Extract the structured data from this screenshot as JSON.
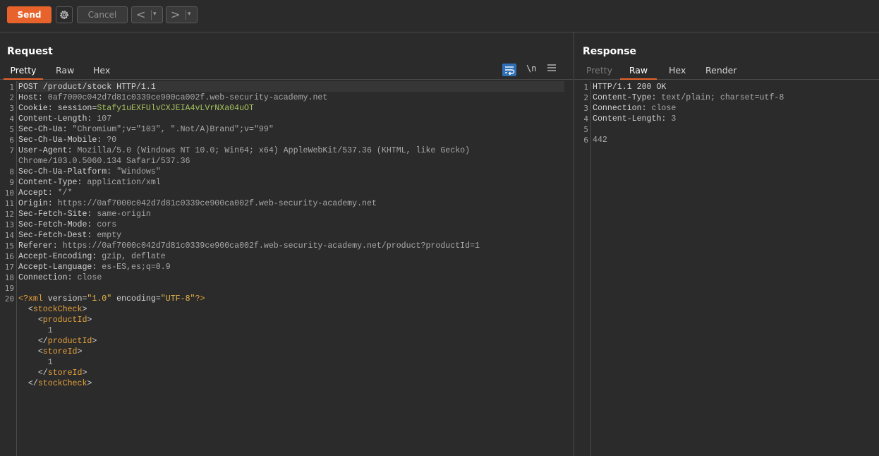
{
  "toolbar": {
    "send_label": "Send",
    "cancel_label": "Cancel",
    "back_arrow": "<",
    "forward_arrow": ">",
    "dropdown_glyph": "▾"
  },
  "request": {
    "title": "Request",
    "tabs": [
      "Pretty",
      "Raw",
      "Hex"
    ],
    "active_tab": "Pretty",
    "tool_newline_label": "\\n",
    "lines": [
      {
        "n": "1",
        "parts": [
          {
            "c": "k",
            "t": "POST /product/stock HTTP/1.1"
          }
        ]
      },
      {
        "n": "2",
        "parts": [
          {
            "c": "k",
            "t": "Host: "
          },
          {
            "c": "v",
            "t": "0af7000c042d7d81c0339ce900ca002f.web-security-academy.net"
          }
        ]
      },
      {
        "n": "3",
        "parts": [
          {
            "c": "k",
            "t": "Cookie: session="
          },
          {
            "c": "g",
            "t": "Stafy1uEXFUlvCXJEIA4vLVrNXa04uOT"
          }
        ]
      },
      {
        "n": "4",
        "parts": [
          {
            "c": "k",
            "t": "Content-Length: "
          },
          {
            "c": "v",
            "t": "107"
          }
        ]
      },
      {
        "n": "5",
        "parts": [
          {
            "c": "k",
            "t": "Sec-Ch-Ua: "
          },
          {
            "c": "v",
            "t": "\"Chromium\";v=\"103\", \".Not/A)Brand\";v=\"99\""
          }
        ]
      },
      {
        "n": "6",
        "parts": [
          {
            "c": "k",
            "t": "Sec-Ch-Ua-Mobile: "
          },
          {
            "c": "v",
            "t": "?0"
          }
        ]
      },
      {
        "n": "7",
        "parts": [
          {
            "c": "k",
            "t": "User-Agent: "
          },
          {
            "c": "v",
            "t": "Mozilla/5.0 (Windows NT 10.0; Win64; x64) AppleWebKit/537.36 (KHTML, like Gecko)"
          }
        ]
      },
      {
        "n": "",
        "parts": [
          {
            "c": "v",
            "t": "Chrome/103.0.5060.134 Safari/537.36"
          }
        ]
      },
      {
        "n": "8",
        "parts": [
          {
            "c": "k",
            "t": "Sec-Ch-Ua-Platform: "
          },
          {
            "c": "v",
            "t": "\"Windows\""
          }
        ]
      },
      {
        "n": "9",
        "parts": [
          {
            "c": "k",
            "t": "Content-Type: "
          },
          {
            "c": "v",
            "t": "application/xml"
          }
        ]
      },
      {
        "n": "10",
        "parts": [
          {
            "c": "k",
            "t": "Accept: "
          },
          {
            "c": "v",
            "t": "*/*"
          }
        ]
      },
      {
        "n": "11",
        "parts": [
          {
            "c": "k",
            "t": "Origin: "
          },
          {
            "c": "v",
            "t": "https://0af7000c042d7d81c0339ce900ca002f.web-security-academy.net"
          }
        ]
      },
      {
        "n": "12",
        "parts": [
          {
            "c": "k",
            "t": "Sec-Fetch-Site: "
          },
          {
            "c": "v",
            "t": "same-origin"
          }
        ]
      },
      {
        "n": "13",
        "parts": [
          {
            "c": "k",
            "t": "Sec-Fetch-Mode: "
          },
          {
            "c": "v",
            "t": "cors"
          }
        ]
      },
      {
        "n": "14",
        "parts": [
          {
            "c": "k",
            "t": "Sec-Fetch-Dest: "
          },
          {
            "c": "v",
            "t": "empty"
          }
        ]
      },
      {
        "n": "15",
        "parts": [
          {
            "c": "k",
            "t": "Referer: "
          },
          {
            "c": "v",
            "t": "https://0af7000c042d7d81c0339ce900ca002f.web-security-academy.net/product?productId=1"
          }
        ]
      },
      {
        "n": "16",
        "parts": [
          {
            "c": "k",
            "t": "Accept-Encoding: "
          },
          {
            "c": "v",
            "t": "gzip, deflate"
          }
        ]
      },
      {
        "n": "17",
        "parts": [
          {
            "c": "k",
            "t": "Accept-Language: "
          },
          {
            "c": "v",
            "t": "es-ES,es;q=0.9"
          }
        ]
      },
      {
        "n": "18",
        "parts": [
          {
            "c": "k",
            "t": "Connection: "
          },
          {
            "c": "v",
            "t": "close"
          }
        ]
      },
      {
        "n": "19",
        "parts": []
      },
      {
        "n": "20",
        "parts": [
          {
            "c": "t",
            "t": "<?xml "
          },
          {
            "c": "k",
            "t": "version="
          },
          {
            "c": "s",
            "t": "\"1.0\""
          },
          {
            "c": "k",
            "t": " encoding="
          },
          {
            "c": "s",
            "t": "\"UTF-8\""
          },
          {
            "c": "t",
            "t": "?>"
          }
        ]
      },
      {
        "n": "",
        "parts": [
          {
            "c": "k",
            "t": "  <"
          },
          {
            "c": "t",
            "t": "stockCheck"
          },
          {
            "c": "k",
            "t": ">"
          }
        ]
      },
      {
        "n": "",
        "parts": [
          {
            "c": "k",
            "t": "    <"
          },
          {
            "c": "t",
            "t": "productId"
          },
          {
            "c": "k",
            "t": ">"
          }
        ]
      },
      {
        "n": "",
        "parts": [
          {
            "c": "v",
            "t": "      1"
          }
        ]
      },
      {
        "n": "",
        "parts": [
          {
            "c": "k",
            "t": "    </"
          },
          {
            "c": "t",
            "t": "productId"
          },
          {
            "c": "k",
            "t": ">"
          }
        ]
      },
      {
        "n": "",
        "parts": [
          {
            "c": "k",
            "t": "    <"
          },
          {
            "c": "t",
            "t": "storeId"
          },
          {
            "c": "k",
            "t": ">"
          }
        ]
      },
      {
        "n": "",
        "parts": [
          {
            "c": "v",
            "t": "      1"
          }
        ]
      },
      {
        "n": "",
        "parts": [
          {
            "c": "k",
            "t": "    </"
          },
          {
            "c": "t",
            "t": "storeId"
          },
          {
            "c": "k",
            "t": ">"
          }
        ]
      },
      {
        "n": "",
        "parts": [
          {
            "c": "k",
            "t": "  </"
          },
          {
            "c": "t",
            "t": "stockCheck"
          },
          {
            "c": "k",
            "t": ">"
          }
        ]
      }
    ]
  },
  "response": {
    "title": "Response",
    "tabs": [
      "Pretty",
      "Raw",
      "Hex",
      "Render"
    ],
    "active_tab": "Raw",
    "disabled_tab": "Pretty",
    "lines": [
      {
        "n": "1",
        "parts": [
          {
            "c": "k",
            "t": "HTTP/1.1 200 OK"
          }
        ]
      },
      {
        "n": "2",
        "parts": [
          {
            "c": "k",
            "t": "Content-Type: "
          },
          {
            "c": "v",
            "t": "text/plain; charset=utf-8"
          }
        ]
      },
      {
        "n": "3",
        "parts": [
          {
            "c": "k",
            "t": "Connection: "
          },
          {
            "c": "v",
            "t": "close"
          }
        ]
      },
      {
        "n": "4",
        "parts": [
          {
            "c": "k",
            "t": "Content-Length: "
          },
          {
            "c": "v",
            "t": "3"
          }
        ]
      },
      {
        "n": "5",
        "parts": []
      },
      {
        "n": "6",
        "parts": [
          {
            "c": "v",
            "t": "442"
          }
        ]
      }
    ]
  },
  "colors": {
    "accent": "#e8632b",
    "background": "#2b2b2b",
    "header_value": "#a8a8a8",
    "cookie_value": "#a7c25e",
    "xml_tag": "#e6a23c",
    "tool_active": "#2f6fb5"
  },
  "icons": {
    "settings": "gear-icon",
    "back": "chevron-left-icon",
    "forward": "chevron-right-icon",
    "wrap": "wrap-lines-icon",
    "menu": "hamburger-menu-icon"
  }
}
